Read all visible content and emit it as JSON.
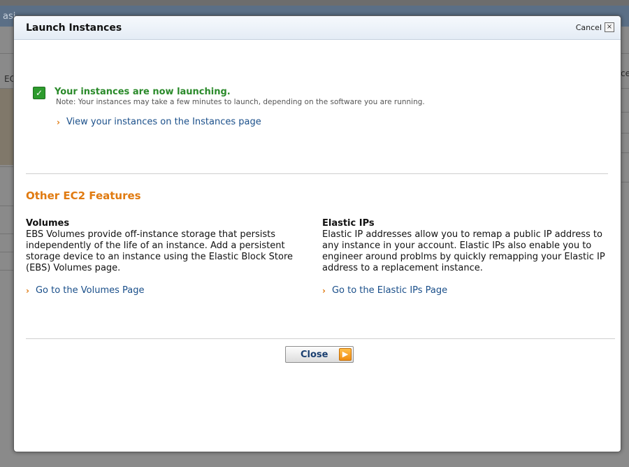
{
  "background": {
    "header_text": "asi",
    "left_label": "EC",
    "right_label": "ce"
  },
  "modal": {
    "title": "Launch Instances",
    "cancel_label": "Cancel",
    "close_x": "×"
  },
  "success": {
    "title": "Your instances are now launching.",
    "note": "Note: Your instances may take a few minutes to launch, depending on the software you are running.",
    "link_label": "View your instances on the Instances page",
    "check_glyph": "✓"
  },
  "features": {
    "section_title": "Other EC2 Features",
    "volumes": {
      "title": "Volumes",
      "description": "EBS Volumes provide off-instance storage that persists independently of the life of an instance. Add a persistent storage device to an instance using the Elastic Block Store (EBS) Volumes page.",
      "link_label": "Go to the Volumes Page"
    },
    "elastic_ips": {
      "title": "Elastic IPs",
      "description": "Elastic IP addresses allow you to remap a public IP address to any instance in your account. Elastic IPs also enable you to engineer around problms by quickly remapping your Elastic IP address to a replacement instance.",
      "link_label": "Go to the Elastic IPs Page"
    }
  },
  "footer": {
    "close_label": "Close",
    "arrow_glyph": "▶"
  },
  "icons": {
    "chevron": "›"
  },
  "colors": {
    "accent_orange": "#e07a10",
    "link_blue": "#1a4f8a",
    "success_green": "#2a8a2a"
  }
}
